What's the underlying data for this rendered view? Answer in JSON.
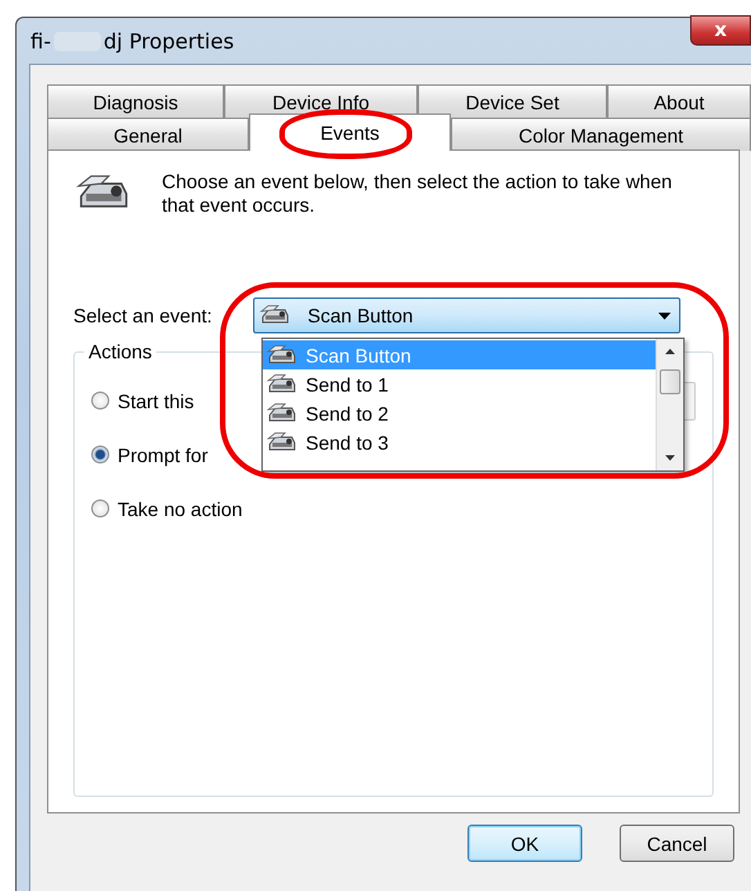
{
  "window": {
    "title_prefix": "fi-",
    "title_suffix": "dj Properties",
    "close": "x"
  },
  "tab_rows": [
    {
      "tabs": [
        {
          "label": "Diagnosis",
          "selected": false
        },
        {
          "label": "Device Info",
          "selected": false
        },
        {
          "label": "Device Set",
          "selected": false
        },
        {
          "label": "About",
          "selected": false
        }
      ]
    },
    {
      "tabs": [
        {
          "label": "General",
          "selected": false
        },
        {
          "label": "Events",
          "selected": true
        },
        {
          "label": "Color Management",
          "selected": false
        }
      ]
    }
  ],
  "description": "Choose an event below, then select the action to take when that event occurs.",
  "event_select": {
    "label": "Select an event:",
    "value": "Scan Button",
    "expanded": true,
    "options": [
      {
        "label": "Scan Button",
        "selected": true
      },
      {
        "label": "Send to 1",
        "selected": false
      },
      {
        "label": "Send to 2",
        "selected": false
      },
      {
        "label": "Send to 3",
        "selected": false
      }
    ]
  },
  "actions": {
    "title": "Actions",
    "options": [
      {
        "label": "Start this",
        "selected": false
      },
      {
        "label": "Prompt for",
        "selected": true
      },
      {
        "label": "Take no action",
        "selected": false
      }
    ]
  },
  "highlights": {
    "selected_tab": true,
    "event_select": true
  },
  "buttons": [
    {
      "label": "OK",
      "default": true
    },
    {
      "label": "Cancel",
      "default": false
    }
  ]
}
